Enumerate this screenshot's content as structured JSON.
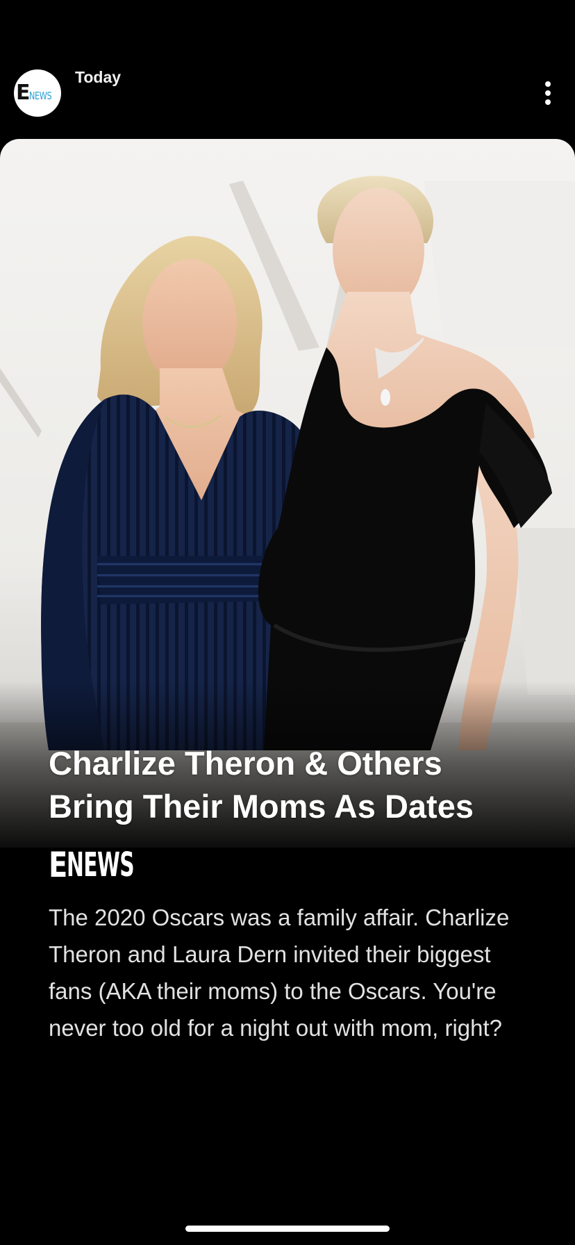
{
  "header": {
    "publisher_logo": {
      "letter": "E",
      "word": "NEWS"
    },
    "timestamp": "Today",
    "more_icon": "vertical-ellipsis-icon"
  },
  "story": {
    "image_alt": "Photo of two women posing together on a red carpet",
    "headline": "Charlize Theron & Others Bring Their Moms As Dates",
    "brand": {
      "letter": "E",
      "word": "NEWS"
    },
    "summary": "The 2020 Oscars was a family affair. Charlize Theron and Laura Dern invited their biggest fans (AKA their moms) to the Oscars. You're never too old for a night out with mom, right?"
  },
  "colors": {
    "background": "#000000",
    "brand_blue": "#2a9fd6",
    "text": "#ffffff"
  }
}
